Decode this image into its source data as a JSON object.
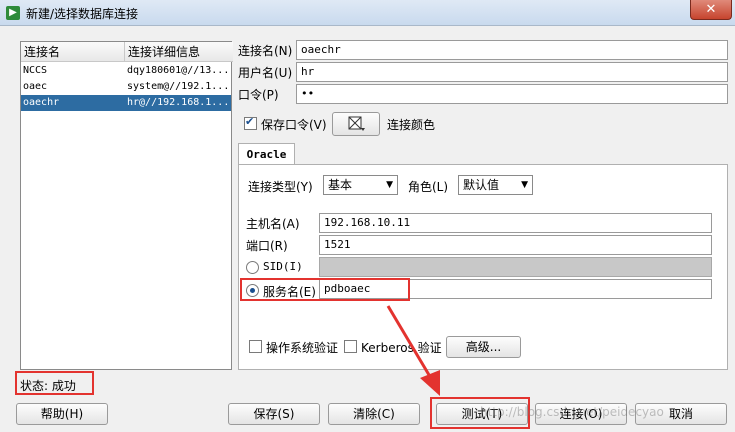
{
  "window": {
    "title": "新建/选择数据库连接",
    "close_icon": "close-icon"
  },
  "list": {
    "headers": [
      "连接名",
      "连接详细信息"
    ],
    "rows": [
      {
        "name": "NCCS",
        "detail": "dqy180601@//13..."
      },
      {
        "name": "oaec",
        "detail": "system@//192.1..."
      },
      {
        "name": "oaechr",
        "detail": "hr@//192.168.1...",
        "selected": true
      }
    ]
  },
  "form": {
    "conn_name_label": "连接名(N)",
    "conn_name_value": "oaechr",
    "user_label": "用户名(U)",
    "user_value": "hr",
    "password_label": "口令(P)",
    "password_value": "••",
    "save_password_label": "保存口令(V)",
    "color_label": "连接颜色"
  },
  "tab": {
    "label": "Oracle"
  },
  "oracle": {
    "conn_type_label": "连接类型(Y)",
    "conn_type_value": "基本",
    "role_label": "角色(L)",
    "role_value": "默认值",
    "host_label": "主机名(A)",
    "host_value": "192.168.10.11",
    "port_label": "端口(R)",
    "port_value": "1521",
    "sid_label": "SID(I)",
    "service_label": "服务名(E)",
    "service_value": "pdboaec",
    "os_auth_label": "操作系统验证",
    "kerberos_label": "Kerberos 验证",
    "advanced_button": "高级..."
  },
  "status": {
    "label": "状态: 成功"
  },
  "buttons": {
    "help": "帮助(H)",
    "save": "保存(S)",
    "clear": "清除(C)",
    "test": "测试(T)",
    "connect": "连接(O)",
    "cancel": "取消"
  },
  "watermark": "http://blog.csdn.net/peidecyao",
  "colors": {
    "selection": "#2d6ca2",
    "highlight": "#e3332f"
  }
}
